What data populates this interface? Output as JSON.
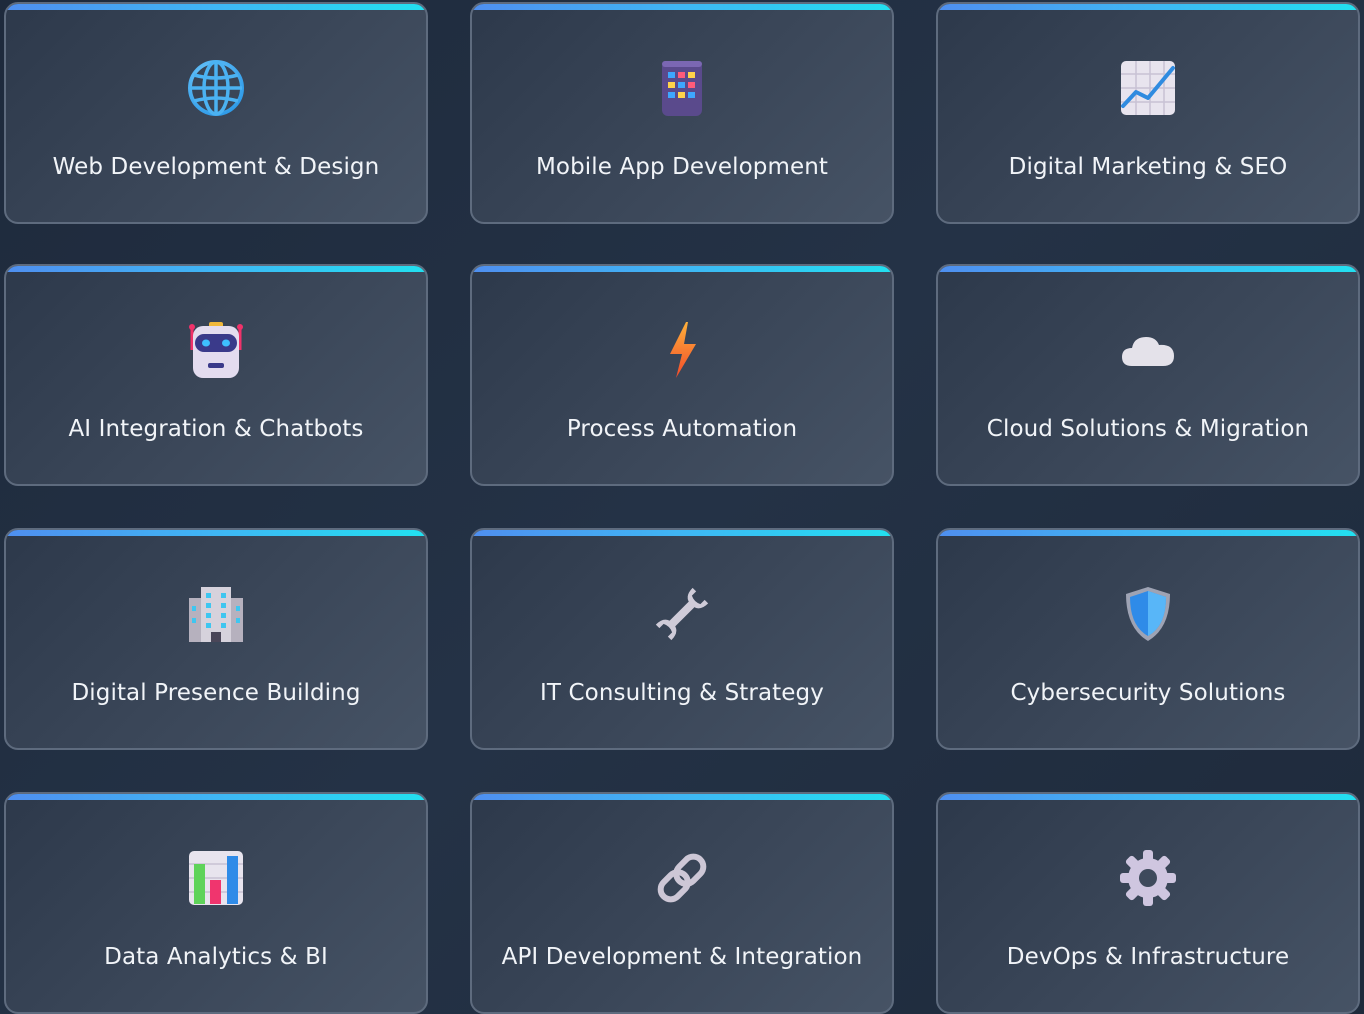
{
  "services": [
    {
      "title": "Web Development & Design",
      "icon": "globe-icon"
    },
    {
      "title": "Mobile App Development",
      "icon": "mobile-phone-icon"
    },
    {
      "title": "Digital Marketing & SEO",
      "icon": "chart-increasing-icon"
    },
    {
      "title": "AI Integration & Chatbots",
      "icon": "robot-icon"
    },
    {
      "title": "Process Automation",
      "icon": "lightning-icon"
    },
    {
      "title": "Cloud Solutions & Migration",
      "icon": "cloud-icon"
    },
    {
      "title": "Digital Presence Building",
      "icon": "office-building-icon"
    },
    {
      "title": "IT Consulting & Strategy",
      "icon": "wrench-icon"
    },
    {
      "title": "Cybersecurity Solutions",
      "icon": "shield-icon"
    },
    {
      "title": "Data Analytics & BI",
      "icon": "bar-chart-icon"
    },
    {
      "title": "API Development & Integration",
      "icon": "link-icon"
    },
    {
      "title": "DevOps & Infrastructure",
      "icon": "gear-icon"
    }
  ],
  "colors": {
    "accent_start": "#4f8ff0",
    "accent_end": "#22e0f0",
    "card_border": "#5e6b7e",
    "text": "#f1f4f8"
  }
}
